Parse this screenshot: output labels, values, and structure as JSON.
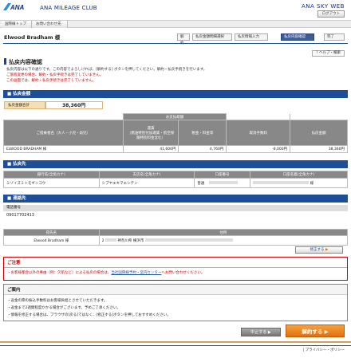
{
  "header": {
    "brand": "ANA",
    "club": "ANA MILEAGE CLUB",
    "sky": "ANA SKY WEB",
    "logout_label": "ログアウト"
  },
  "nav": {
    "items": [
      "国際線トップ",
      "お問い合わせ先"
    ]
  },
  "member": {
    "name": "Elwood Bradham 様"
  },
  "steps": [
    "解約",
    "払戻金額明細選択",
    "払戻情報入力",
    "払戻内容確認",
    "完了"
  ],
  "help_label": "ヘルプ・検索",
  "page_title": "払戻内容確認",
  "intro": {
    "line1": "払戻内容は以下の通りです。この内容でよろしければ、[解約する] ボタンを押してください。解約・払戻手続きを行います。",
    "line2": "ご旅程変更の場合、解約・払戻手続きは完了していません。",
    "line3": "この画面では、解約・払戻手続きは完了していません。"
  },
  "sections": {
    "refund_amount": "払戻金額",
    "refund_account": "払戻先",
    "contact": "連絡先"
  },
  "amount": {
    "label": "払戻金額合計",
    "value": "38,360円"
  },
  "fare_table": {
    "group_header": "お支払総額",
    "headers": [
      "ご搭乗者名（大人・小児・幼児）",
      "運賃\n（燃油特別付加運賃・航空保険特別料金含む）",
      "税金・料金等",
      "取消手数料",
      "払戻金額"
    ],
    "row": [
      "ELWOOD BRADHAM 様",
      "41,600円",
      "4,760円",
      "-8,000円",
      "38,360円"
    ]
  },
  "account_table": {
    "headers": [
      "銀行名(全角カナ)",
      "支店名(全角カナ)",
      "口座番号",
      "口座名義(全角カナ)"
    ],
    "row": [
      "ミゾイズミトモギンコウ",
      "シブヤエキマエシテン",
      "普通",
      "様"
    ]
  },
  "contact": {
    "phone_label": "電話番号",
    "phone": "09017702413",
    "address_headers": [
      "宛先名",
      "住所"
    ],
    "name": "Elwood Bradham 様",
    "address_prefix": "2",
    "address_city": "神奈川県 横浜市"
  },
  "modify_label": "修正する",
  "warning": {
    "title": "ご注意",
    "text_a": "・お客様都合以外の事由（例：欠航など）による払戻の場合は、",
    "link": "当社国際線予約・案内センター",
    "text_b": "へお問い合わせください。"
  },
  "guide": {
    "title": "ご案内",
    "items": [
      "・返金の際の振込手数料はお客様負担とさせていただきます。",
      "・返金まで2週間程度かかる場合がございます。予めご了承ください。",
      "・情報を修正する場合は、ブラウザの[戻る]ではなく、[修正する]ボタンを押しておすすめください。"
    ]
  },
  "buttons": {
    "cancel": "中止する",
    "refund": "解約する"
  },
  "footer": {
    "privacy": "プライバシー・ポリシー"
  },
  "colors": {
    "brand_blue": "#1f4e98",
    "accent_orange": "#e0700e",
    "warn_red": "#cc0000"
  }
}
